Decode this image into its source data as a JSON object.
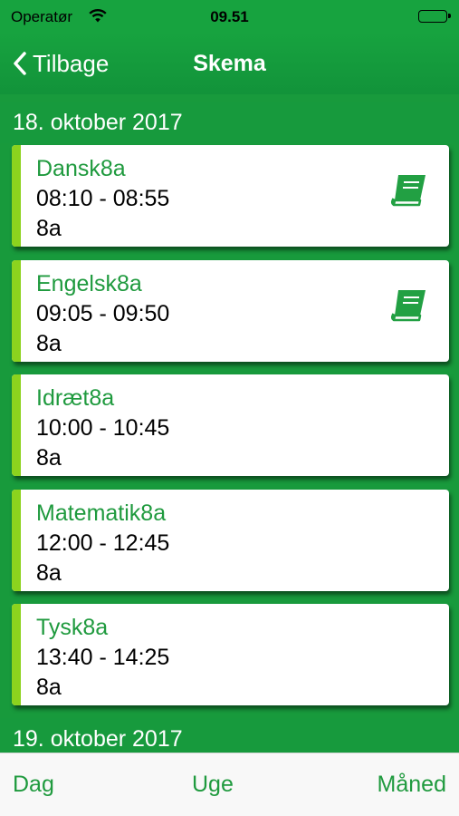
{
  "status": {
    "carrier": "Operatør",
    "time": "09.51"
  },
  "nav": {
    "back_label": "Tilbage",
    "title": "Skema"
  },
  "days": [
    {
      "date": "18. oktober 2017",
      "lessons": [
        {
          "subject": "Dansk8a",
          "time": "08:10 - 08:55",
          "room": "8a",
          "homework": true
        },
        {
          "subject": "Engelsk8a",
          "time": "09:05 - 09:50",
          "room": "8a",
          "homework": true
        },
        {
          "subject": "Idræt8a",
          "time": "10:00 - 10:45",
          "room": "8a",
          "homework": false
        },
        {
          "subject": "Matematik8a",
          "time": "12:00 - 12:45",
          "room": "8a",
          "homework": false
        },
        {
          "subject": "Tysk8a",
          "time": "13:40 - 14:25",
          "room": "8a",
          "homework": false
        }
      ]
    },
    {
      "date": "19. oktober 2017",
      "lessons": []
    }
  ],
  "tabs": {
    "day": "Dag",
    "week": "Uge",
    "month": "Måned"
  },
  "colors": {
    "primary": "#179a3d",
    "accent_bar": "#8cd31e",
    "subject_text": "#1f9a3e"
  },
  "icons": {
    "back": "chevron-left-icon",
    "homework": "book-icon",
    "wifi": "wifi-icon",
    "battery": "battery-icon"
  }
}
